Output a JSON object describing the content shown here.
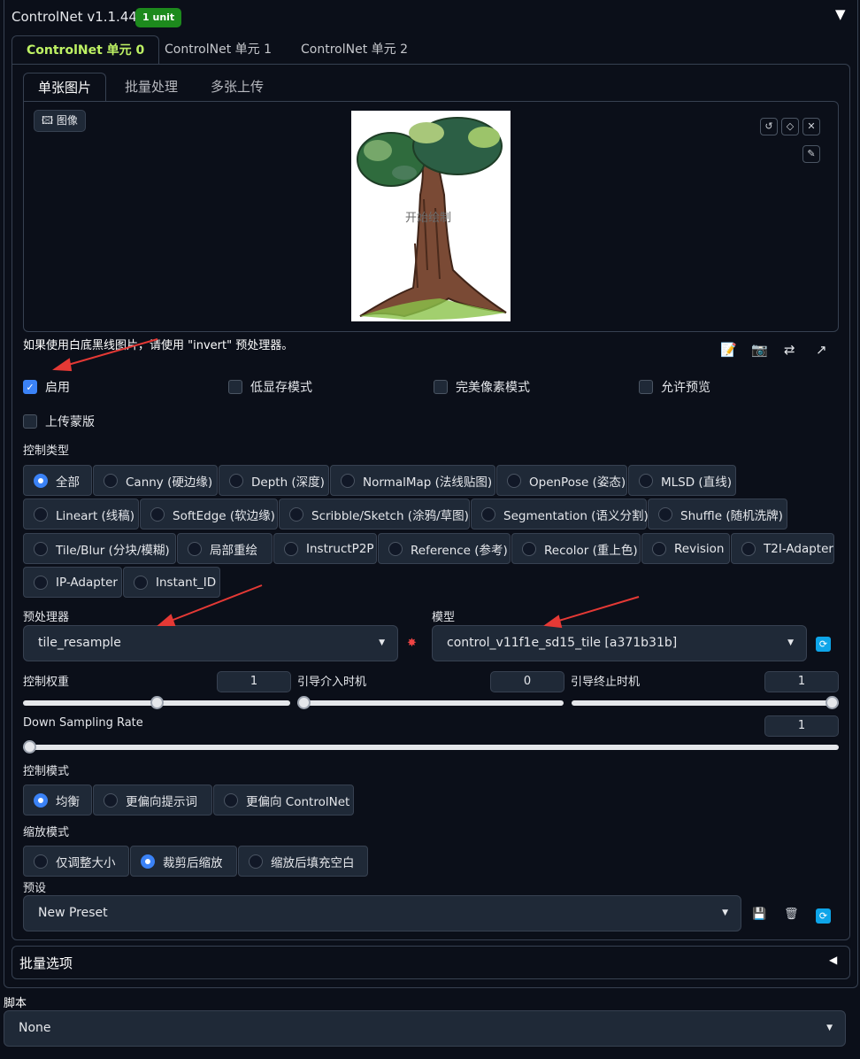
{
  "header": {
    "title": "ControlNet v1.1.440",
    "badge": "1 unit",
    "collapse_icon": "triangle-down"
  },
  "unit_tabs": [
    "ControlNet 单元 0",
    "ControlNet 单元 1",
    "ControlNet 单元 2"
  ],
  "input_tabs": [
    "单张图片",
    "批量处理",
    "多张上传"
  ],
  "image_panel": {
    "label": "图像",
    "draw_hint": "开始绘制",
    "tools": [
      "undo-icon",
      "eraser-icon",
      "close-icon",
      "brush-icon"
    ]
  },
  "hint_text": "如果使用白底黑线图片，请使用 \"invert\" 预处理器。",
  "options": {
    "enable": "启用",
    "low_vram": "低显存模式",
    "pixel_perfect": "完美像素模式",
    "allow_preview": "允许预览",
    "upload_mask": "上传蒙版"
  },
  "control_type": {
    "label": "控制类型",
    "selected": "全部",
    "items": [
      "全部",
      "Canny (硬边缘)",
      "Depth (深度)",
      "NormalMap (法线贴图)",
      "OpenPose (姿态)",
      "MLSD (直线)",
      "Lineart (线稿)",
      "SoftEdge (软边缘)",
      "Scribble/Sketch (涂鸦/草图)",
      "Segmentation (语义分割)",
      "Shuffle (随机洗牌)",
      "Tile/Blur (分块/模糊)",
      "局部重绘",
      "InstructP2P",
      "Reference (参考)",
      "Recolor (重上色)",
      "Revision",
      "T2I-Adapter",
      "IP-Adapter",
      "Instant_ID"
    ]
  },
  "preprocessor": {
    "label": "预处理器",
    "value": "tile_resample"
  },
  "model": {
    "label": "模型",
    "value": "control_v11f1e_sd15_tile [a371b31b]"
  },
  "sliders": {
    "control_weight": {
      "label": "控制权重",
      "value": "1",
      "fraction": 0.5
    },
    "start_step": {
      "label": "引导介入时机",
      "value": "0",
      "fraction": 0
    },
    "end_step": {
      "label": "引导终止时机",
      "value": "1",
      "fraction": 1
    },
    "down_sampling": {
      "label": "Down Sampling Rate",
      "value": "1",
      "fraction": 0
    }
  },
  "control_mode": {
    "label": "控制模式",
    "selected": "均衡",
    "items": [
      "均衡",
      "更偏向提示词",
      "更偏向 ControlNet"
    ]
  },
  "resize_mode": {
    "label": "缩放模式",
    "selected": "裁剪后缩放",
    "items": [
      "仅调整大小",
      "裁剪后缩放",
      "缩放后填充空白"
    ]
  },
  "preset": {
    "label": "预设",
    "value": "New Preset"
  },
  "batch_options": {
    "label": "批量选项"
  },
  "script": {
    "label": "脚本",
    "value": "None"
  },
  "colors": {
    "accent": "#3b82f6",
    "tab_active": "#bef264",
    "badge": "#1d8a1d",
    "annotation_arrow": "#e53935"
  }
}
